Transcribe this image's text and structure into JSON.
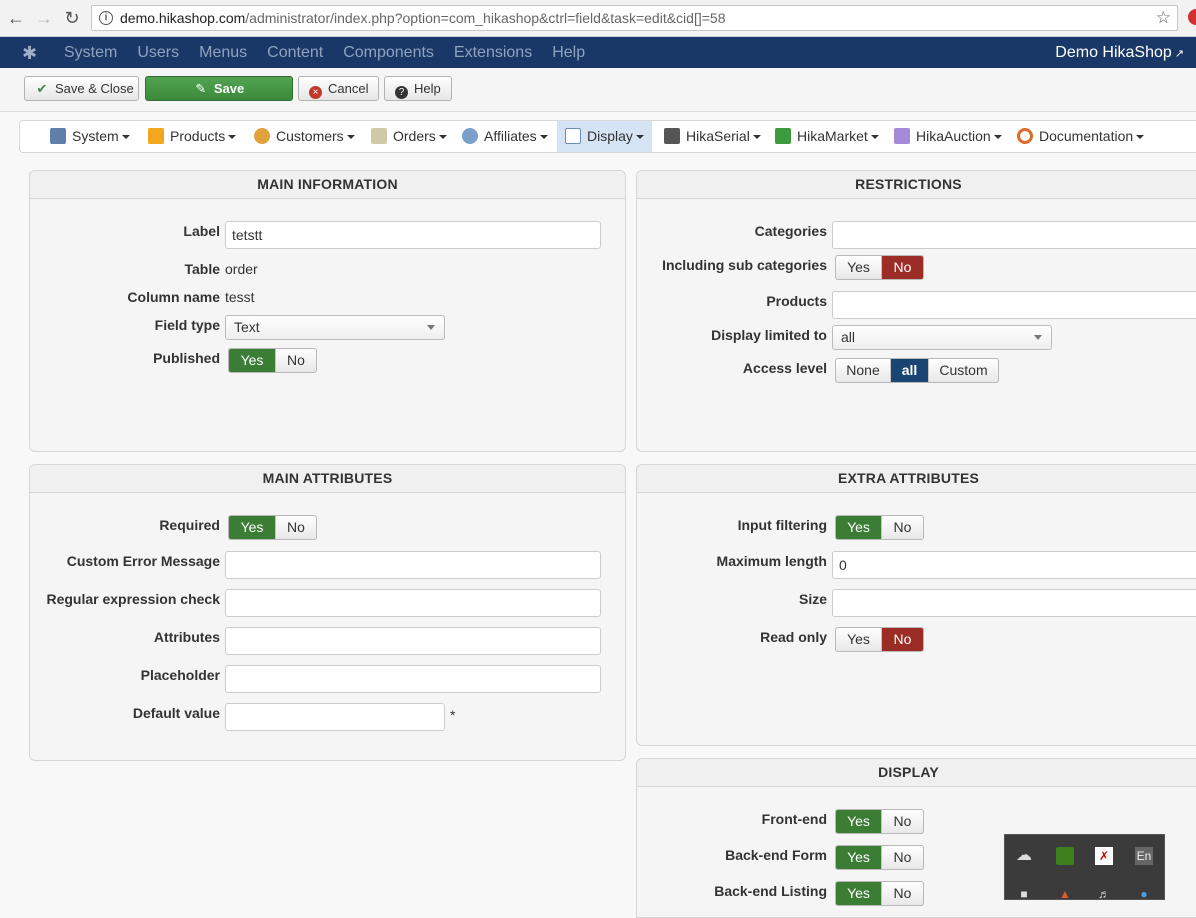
{
  "browser": {
    "url_host": "demo.hikashop.com",
    "url_path": "/administrator/index.php?option=com_hikashop&ctrl=field&task=edit&cid[]=58"
  },
  "admin_menu": [
    "System",
    "Users",
    "Menus",
    "Content",
    "Components",
    "Extensions",
    "Help"
  ],
  "site_link": "Demo HikaShop",
  "toolbar": {
    "save_close": "Save & Close",
    "save": "Save",
    "cancel": "Cancel",
    "help": "Help"
  },
  "hika_menu": [
    "System",
    "Products",
    "Customers",
    "Orders",
    "Affiliates",
    "Display",
    "HikaSerial",
    "HikaMarket",
    "HikaAuction",
    "Documentation"
  ],
  "main_info": {
    "title": "MAIN INFORMATION",
    "label_lbl": "Label",
    "label_val": "tetstt",
    "table_lbl": "Table",
    "table_val": "order",
    "column_lbl": "Column name",
    "column_val": "tesst",
    "fieldtype_lbl": "Field type",
    "fieldtype_val": "Text",
    "published_lbl": "Published"
  },
  "restrictions": {
    "title": "RESTRICTIONS",
    "categories_lbl": "Categories",
    "subcat_lbl": "Including sub categories",
    "products_lbl": "Products",
    "display_limited_lbl": "Display limited to",
    "display_limited_val": "all",
    "access_lbl": "Access level",
    "access_none": "None",
    "access_all": "all",
    "access_custom": "Custom"
  },
  "main_attr": {
    "title": "MAIN ATTRIBUTES",
    "required_lbl": "Required",
    "error_lbl": "Custom Error Message",
    "regex_lbl": "Regular expression check",
    "attributes_lbl": "Attributes",
    "placeholder_lbl": "Placeholder",
    "default_lbl": "Default value",
    "default_mark": "*"
  },
  "extra_attr": {
    "title": "EXTRA ATTRIBUTES",
    "filter_lbl": "Input filtering",
    "maxlen_lbl": "Maximum length",
    "maxlen_val": "0",
    "size_lbl": "Size",
    "readonly_lbl": "Read only"
  },
  "display": {
    "title": "DISPLAY",
    "frontend_lbl": "Front-end",
    "backform_lbl": "Back-end Form",
    "backlist_lbl": "Back-end Listing"
  },
  "yes": "Yes",
  "no": "No",
  "tray_lang": "En",
  "colors": {
    "green": "#3b7d35",
    "red": "#9b2c26",
    "blue": "#1a4573",
    "header": "#1a3867"
  }
}
